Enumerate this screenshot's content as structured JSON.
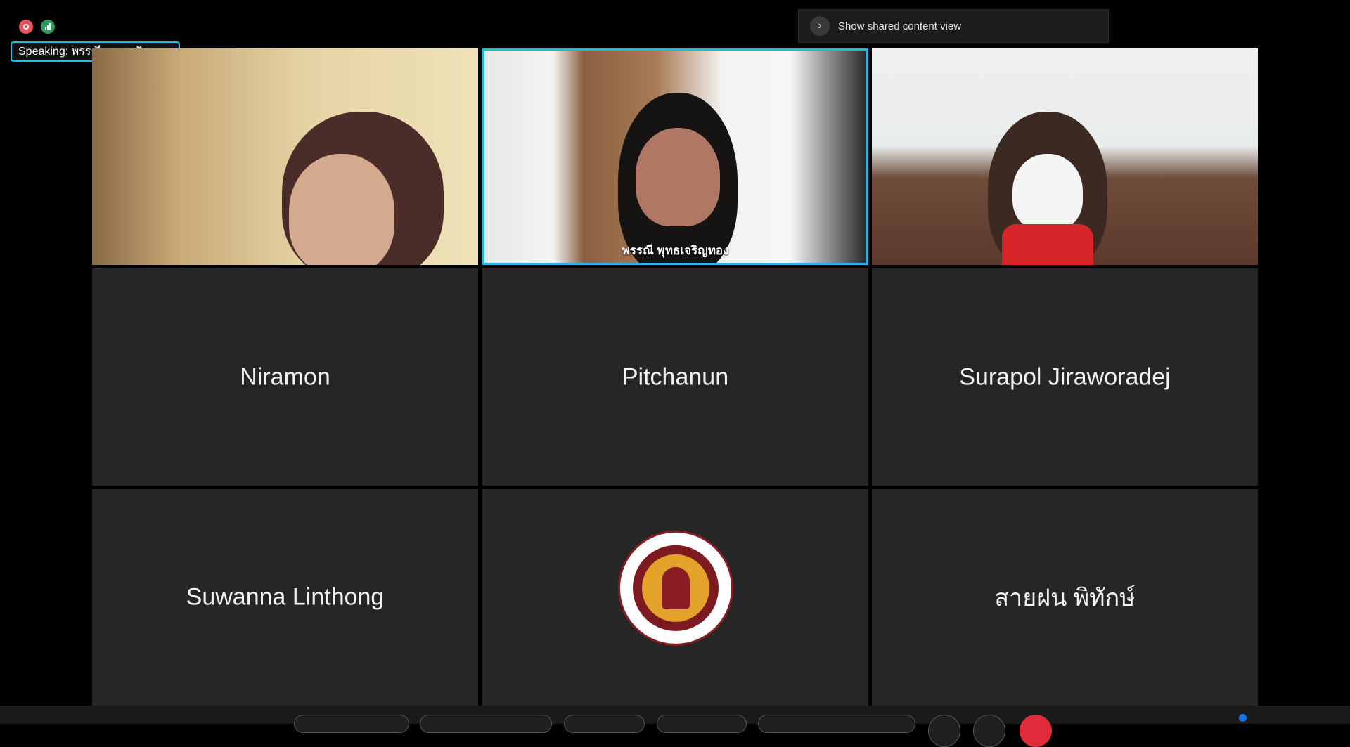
{
  "status": {
    "recording_icon": "recording-icon",
    "stats_icon": "connection-stats-icon",
    "speaking_label": "Speaking: พรรณี พุทธเจริญทอง"
  },
  "shared_content": {
    "label": "Show shared content view",
    "icon": "chevron-right-icon"
  },
  "tiles": [
    {
      "type": "video",
      "name": ""
    },
    {
      "type": "video",
      "name": "พรรณี พุทธเจริญทอง",
      "active": true
    },
    {
      "type": "video",
      "name": ""
    },
    {
      "type": "name",
      "name": "Niramon"
    },
    {
      "type": "name",
      "name": "Pitchanun"
    },
    {
      "type": "name",
      "name": "Surapol Jiraworadej"
    },
    {
      "type": "name",
      "name": "Suwanna Linthong"
    },
    {
      "type": "logo",
      "name": ""
    },
    {
      "type": "name",
      "name": "สายฝน พิทักษ์"
    }
  ],
  "colors": {
    "active_border": "#22b5e4",
    "tile_bg": "#262626",
    "end_button": "#e02c3a"
  }
}
